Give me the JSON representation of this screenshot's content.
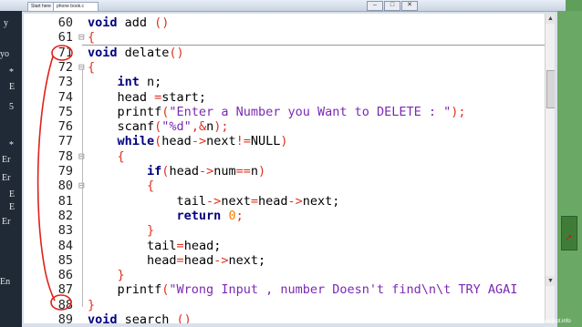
{
  "tabs": [
    {
      "label": "Start here"
    },
    {
      "label": "phone book.c"
    }
  ],
  "window_controls": [
    "–",
    "□",
    "✕"
  ],
  "left_panel_chars": [
    "y",
    "yo",
    "*",
    "E",
    "5",
    "*",
    "Er",
    "Er",
    "E",
    "E",
    "Er",
    "En"
  ],
  "watermark": "www.fppt.info",
  "code": {
    "lines": [
      {
        "n": "60",
        "fold": "",
        "tokens": [
          {
            "t": "void",
            "c": "kw"
          },
          {
            "t": " add ",
            "c": "fn"
          },
          {
            "t": "()",
            "c": "op"
          }
        ]
      },
      {
        "n": "61",
        "fold": "⊟",
        "tokens": [
          {
            "t": "{",
            "c": "op"
          }
        ]
      },
      {
        "n": "71",
        "fold": "",
        "tokens": [
          {
            "t": "void",
            "c": "kw"
          },
          {
            "t": " delate",
            "c": "fn"
          },
          {
            "t": "()",
            "c": "op"
          }
        ]
      },
      {
        "n": "72",
        "fold": "⊟",
        "tokens": [
          {
            "t": "{",
            "c": "op"
          }
        ]
      },
      {
        "n": "73",
        "fold": "",
        "tokens": [
          {
            "t": "    ",
            "c": "fn"
          },
          {
            "t": "int",
            "c": "kw"
          },
          {
            "t": " n;",
            "c": "fn"
          }
        ]
      },
      {
        "n": "74",
        "fold": "",
        "tokens": [
          {
            "t": "    head ",
            "c": "fn"
          },
          {
            "t": "=",
            "c": "op"
          },
          {
            "t": "start;",
            "c": "fn"
          }
        ]
      },
      {
        "n": "75",
        "fold": "",
        "tokens": [
          {
            "t": "    printf",
            "c": "fn"
          },
          {
            "t": "(",
            "c": "op"
          },
          {
            "t": "\"Enter a Number you Want to DELETE : \"",
            "c": "str"
          },
          {
            "t": ");",
            "c": "op"
          }
        ]
      },
      {
        "n": "76",
        "fold": "",
        "tokens": [
          {
            "t": "    scanf",
            "c": "fn"
          },
          {
            "t": "(",
            "c": "op"
          },
          {
            "t": "\"%d\"",
            "c": "str"
          },
          {
            "t": ",&",
            "c": "op"
          },
          {
            "t": "n",
            "c": "fn"
          },
          {
            "t": ");",
            "c": "op"
          }
        ]
      },
      {
        "n": "77",
        "fold": "",
        "tokens": [
          {
            "t": "    ",
            "c": "fn"
          },
          {
            "t": "while",
            "c": "kw"
          },
          {
            "t": "(",
            "c": "op"
          },
          {
            "t": "head",
            "c": "fn"
          },
          {
            "t": "->",
            "c": "op"
          },
          {
            "t": "next",
            "c": "fn"
          },
          {
            "t": "!=",
            "c": "op"
          },
          {
            "t": "NULL",
            "c": "fn"
          },
          {
            "t": ")",
            "c": "op"
          }
        ]
      },
      {
        "n": "78",
        "fold": "⊟",
        "tokens": [
          {
            "t": "    ",
            "c": "fn"
          },
          {
            "t": "{",
            "c": "op"
          }
        ]
      },
      {
        "n": "79",
        "fold": "",
        "tokens": [
          {
            "t": "        ",
            "c": "fn"
          },
          {
            "t": "if",
            "c": "kw"
          },
          {
            "t": "(",
            "c": "op"
          },
          {
            "t": "head",
            "c": "fn"
          },
          {
            "t": "->",
            "c": "op"
          },
          {
            "t": "num",
            "c": "fn"
          },
          {
            "t": "==",
            "c": "op"
          },
          {
            "t": "n",
            "c": "fn"
          },
          {
            "t": ")",
            "c": "op"
          }
        ]
      },
      {
        "n": "80",
        "fold": "⊟",
        "tokens": [
          {
            "t": "        ",
            "c": "fn"
          },
          {
            "t": "{",
            "c": "op"
          }
        ]
      },
      {
        "n": "81",
        "fold": "",
        "tokens": [
          {
            "t": "            tail",
            "c": "fn"
          },
          {
            "t": "->",
            "c": "op"
          },
          {
            "t": "next",
            "c": "fn"
          },
          {
            "t": "=",
            "c": "op"
          },
          {
            "t": "head",
            "c": "fn"
          },
          {
            "t": "->",
            "c": "op"
          },
          {
            "t": "next;",
            "c": "fn"
          }
        ]
      },
      {
        "n": "82",
        "fold": "",
        "tokens": [
          {
            "t": "            ",
            "c": "fn"
          },
          {
            "t": "return",
            "c": "kw"
          },
          {
            "t": " ",
            "c": "fn"
          },
          {
            "t": "0",
            "c": "num"
          },
          {
            "t": ";",
            "c": "op"
          }
        ]
      },
      {
        "n": "83",
        "fold": "",
        "tokens": [
          {
            "t": "        ",
            "c": "fn"
          },
          {
            "t": "}",
            "c": "op"
          }
        ]
      },
      {
        "n": "84",
        "fold": "",
        "tokens": [
          {
            "t": "        tail",
            "c": "fn"
          },
          {
            "t": "=",
            "c": "op"
          },
          {
            "t": "head;",
            "c": "fn"
          }
        ]
      },
      {
        "n": "85",
        "fold": "",
        "tokens": [
          {
            "t": "        head",
            "c": "fn"
          },
          {
            "t": "=",
            "c": "op"
          },
          {
            "t": "head",
            "c": "fn"
          },
          {
            "t": "->",
            "c": "op"
          },
          {
            "t": "next;",
            "c": "fn"
          }
        ]
      },
      {
        "n": "86",
        "fold": "",
        "tokens": [
          {
            "t": "    ",
            "c": "fn"
          },
          {
            "t": "}",
            "c": "op"
          }
        ]
      },
      {
        "n": "87",
        "fold": "",
        "tokens": [
          {
            "t": "    printf",
            "c": "fn"
          },
          {
            "t": "(",
            "c": "op"
          },
          {
            "t": "\"Wrong Input , number Doesn't find\\n\\t TRY AGAI",
            "c": "str"
          }
        ]
      },
      {
        "n": "88",
        "fold": "",
        "tokens": [
          {
            "t": "}",
            "c": "op"
          }
        ]
      },
      {
        "n": "89",
        "fold": "",
        "tokens": [
          {
            "t": "void",
            "c": "kw"
          },
          {
            "t": " search ",
            "c": "fn"
          },
          {
            "t": "()",
            "c": "op"
          }
        ]
      }
    ]
  },
  "colors": {
    "keyword": "#000080",
    "string": "#7a29b3",
    "operator": "#e0301e",
    "number": "#ff7a00",
    "annotation": "#e0201a"
  }
}
